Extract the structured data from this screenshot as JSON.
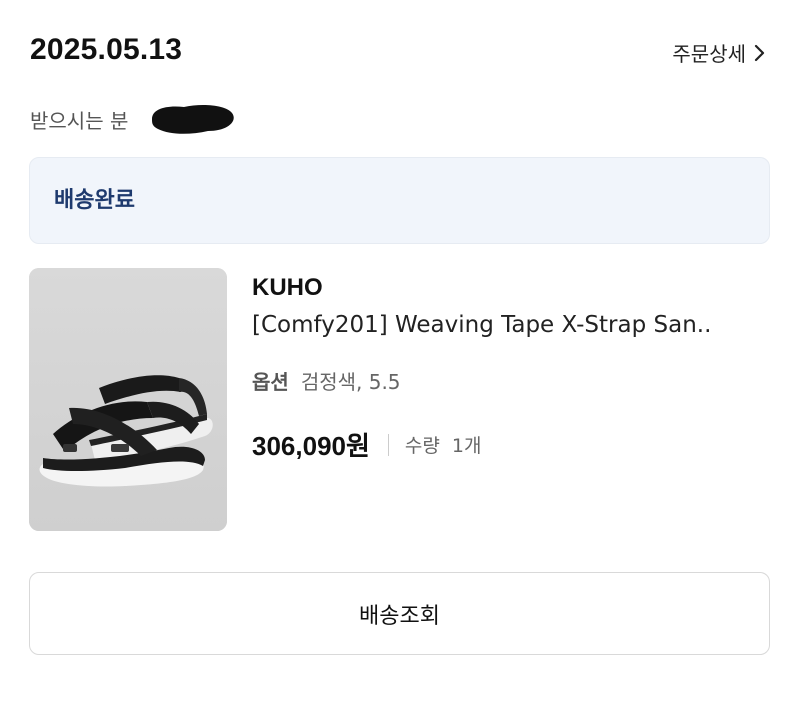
{
  "order": {
    "date": "2025.05.13",
    "detail_link_label": "주문상세",
    "recipient_label": "받으시는 분"
  },
  "status": {
    "label": "배송완료",
    "color": "#1e3a6e",
    "background": "#f1f5fb"
  },
  "product": {
    "brand": "KUHO",
    "name": "[Comfy201] Weaving Tape X-Strap San..",
    "option_label": "옵션",
    "option_value": "검정색, 5.5",
    "price": "306,090원",
    "quantity_label": "수량",
    "quantity_value": "1개",
    "image_icon": "sandal-image"
  },
  "actions": {
    "track_label": "배송조회"
  }
}
